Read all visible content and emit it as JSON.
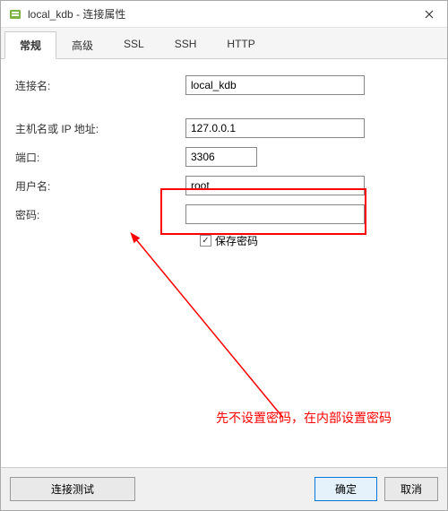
{
  "window": {
    "title": "local_kdb - 连接属性"
  },
  "tabs": {
    "general": "常规",
    "advanced": "高级",
    "ssl": "SSL",
    "ssh": "SSH",
    "http": "HTTP"
  },
  "form": {
    "connection_name_label": "连接名:",
    "connection_name_value": "local_kdb",
    "host_label": "主机名或 IP 地址:",
    "host_value": "127.0.0.1",
    "port_label": "端口:",
    "port_value": "3306",
    "username_label": "用户名:",
    "username_value": "root",
    "password_label": "密码:",
    "password_value": "",
    "save_password_label": "保存密码"
  },
  "annotation": {
    "text": "先不设置密码，在内部设置密码"
  },
  "footer": {
    "test": "连接测试",
    "ok": "确定",
    "cancel": "取消"
  }
}
